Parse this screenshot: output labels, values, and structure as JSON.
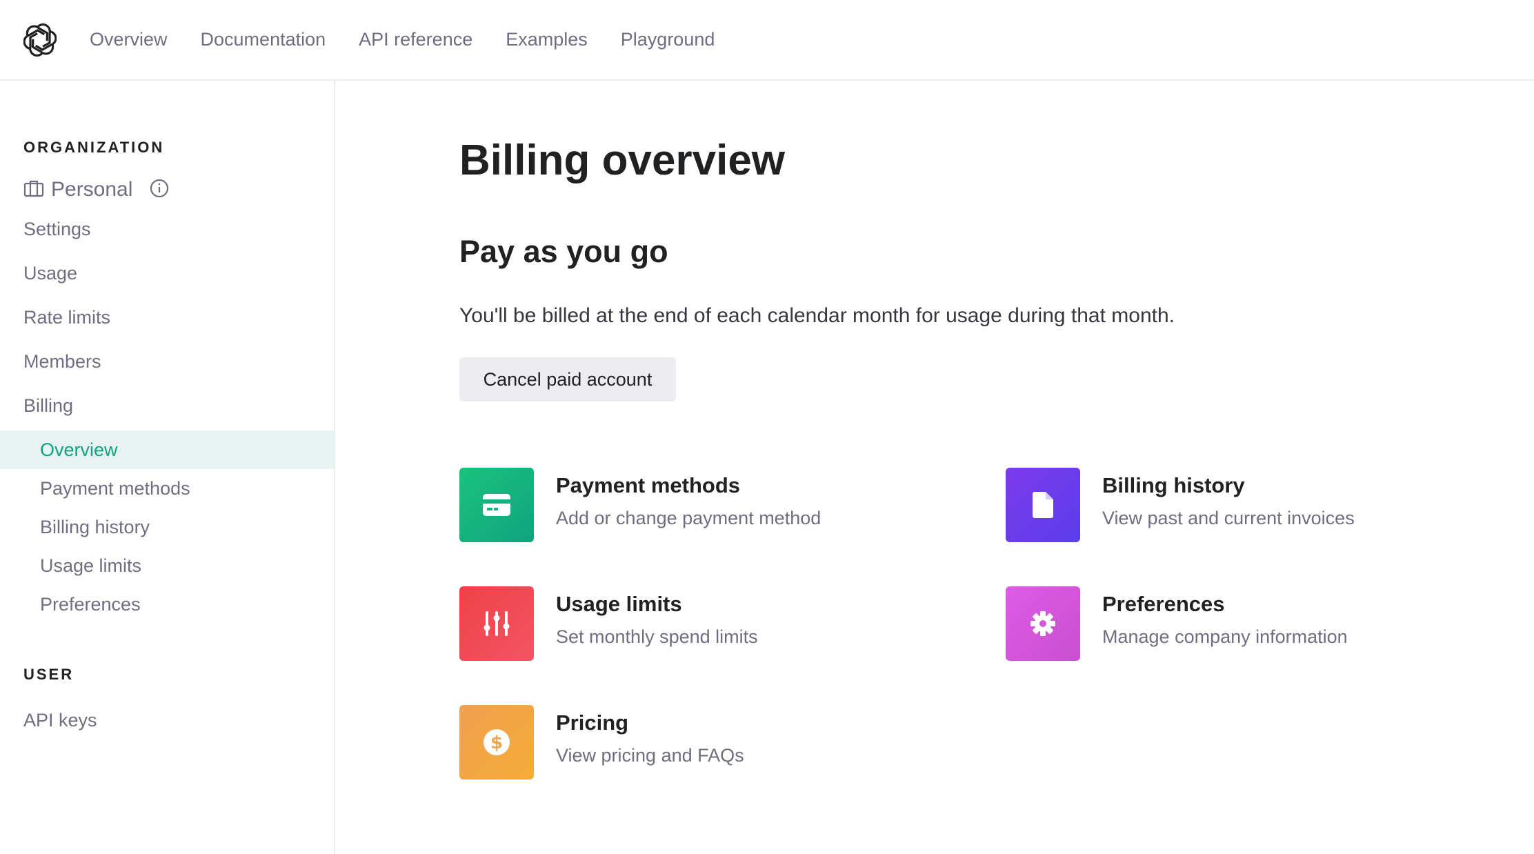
{
  "topnav": {
    "logo_icon": "openai-logo-icon",
    "links": [
      "Overview",
      "Documentation",
      "API reference",
      "Examples",
      "Playground"
    ]
  },
  "sidebar": {
    "organization_label": "ORGANIZATION",
    "org_name": "Personal",
    "org_icon": "briefcase-icon",
    "info_icon": "info-circle-icon",
    "items": [
      "Settings",
      "Usage",
      "Rate limits",
      "Members",
      "Billing"
    ],
    "billing_subitems": [
      "Overview",
      "Payment methods",
      "Billing history",
      "Usage limits",
      "Preferences"
    ],
    "active_subitem": "Overview",
    "user_label": "USER",
    "user_items": [
      "API keys"
    ]
  },
  "main": {
    "title": "Billing overview",
    "plan_title": "Pay as you go",
    "plan_description": "You'll be billed at the end of each calendar month for usage during that month.",
    "cancel_button": "Cancel paid account",
    "cards": [
      {
        "title": "Payment methods",
        "description": "Add or change payment method",
        "icon": "credit-card-icon",
        "color": "#19c37d"
      },
      {
        "title": "Billing history",
        "description": "View past and current invoices",
        "icon": "document-icon",
        "color": "#6b3ee8"
      },
      {
        "title": "Usage limits",
        "description": "Set monthly spend limits",
        "icon": "sliders-icon",
        "color": "#ef4146"
      },
      {
        "title": "Preferences",
        "description": "Manage company information",
        "icon": "gear-icon",
        "color": "#dd5ce5"
      },
      {
        "title": "Pricing",
        "description": "View pricing and FAQs",
        "icon": "dollar-coin-icon",
        "color": "#f4ac36"
      }
    ]
  },
  "colors": {
    "accent": "#10a37f",
    "active_bg": "#e6f3f2",
    "muted_text": "#6e6e80",
    "border": "#ececf1"
  }
}
